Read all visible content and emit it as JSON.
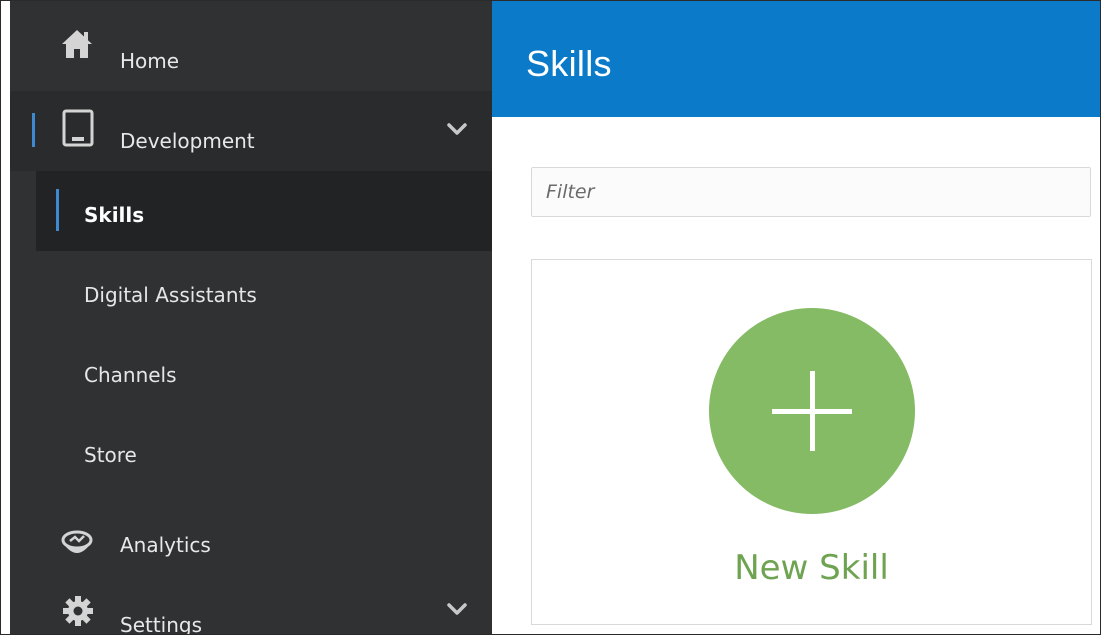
{
  "sidebar": {
    "home": {
      "label": "Home",
      "icon": "home-icon"
    },
    "development": {
      "label": "Development",
      "icon": "tablet-icon",
      "expanded": true,
      "items": [
        {
          "label": "Skills",
          "active": true
        },
        {
          "label": "Digital Assistants"
        },
        {
          "label": "Channels"
        },
        {
          "label": "Store"
        }
      ]
    },
    "analytics": {
      "label": "Analytics",
      "icon": "analytics-icon"
    },
    "settings": {
      "label": "Settings",
      "icon": "gear-icon"
    }
  },
  "header": {
    "title": "Skills"
  },
  "filter": {
    "placeholder": "Filter",
    "value": ""
  },
  "new_skill_card": {
    "label": "New Skill",
    "icon": "plus-icon"
  },
  "colors": {
    "sidebar_bg": "#303133",
    "header_bg": "#0a7ac9",
    "accent": "#3d8ad0",
    "new_skill_green": "#85bb65"
  }
}
